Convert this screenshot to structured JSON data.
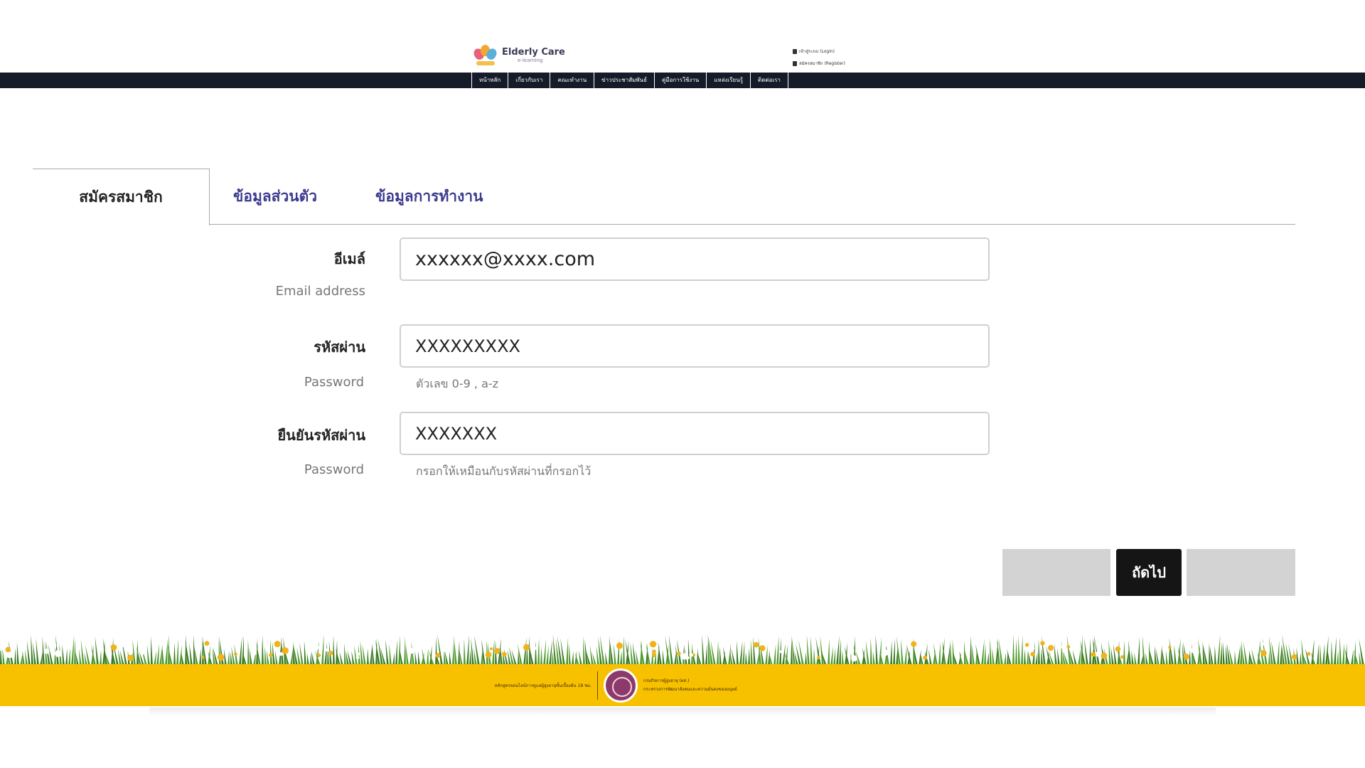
{
  "header": {
    "logo_title": "Elderly Care",
    "logo_subtitle": "e-learning",
    "account_links": [
      "เข้าสู่ระบบ (Login)",
      "สมัครสมาชิก (Register)"
    ]
  },
  "nav": {
    "items": [
      "หน้าหลัก",
      "เกี่ยวกับเรา",
      "คณะทำงาน",
      "ข่าวประชาสัมพันธ์",
      "คู่มือการใช้งาน",
      "แหล่งเรียนรู้",
      "ติดต่อเรา"
    ]
  },
  "tabs": [
    {
      "label": "สมัครสมาชิก",
      "active": true
    },
    {
      "label": "ข้อมูลส่วนตัว",
      "active": false
    },
    {
      "label": "ข้อมูลการทำงาน",
      "active": false
    }
  ],
  "form": {
    "email": {
      "label": "อีเมล์",
      "sublabel": "Email address",
      "value": "xxxxxx@xxxx.com",
      "hint": ""
    },
    "password": {
      "label": "รหัสผ่าน",
      "sublabel": "Password",
      "value": "XXXXXXXXX",
      "hint": "ตัวเลข 0-9 , a-z"
    },
    "confirm": {
      "label": "ยืนยันรหัสผ่าน",
      "sublabel": "Password",
      "value": "XXXXXXX",
      "hint": "กรอกให้เหมือนกับรหัสผ่านที่กรอกไว้"
    }
  },
  "buttons": {
    "next_label": "ถัดไป"
  },
  "footer": {
    "left_text": "หลักสูตรออนไลน์การดูแลผู้สูงอายุขั้นเบื้องต้น 18 ชม.",
    "right_line1": "กรมกิจการผู้สูงอายุ (ผส.)",
    "right_line2": "กระทรวงการพัฒนาสังคมและความมั่นคงของมนุษย์"
  },
  "colors": {
    "navbar": "#161b2a",
    "tab_link": "#3b3b8f",
    "footer_band": "#f8c100",
    "next_button": "#151515"
  }
}
